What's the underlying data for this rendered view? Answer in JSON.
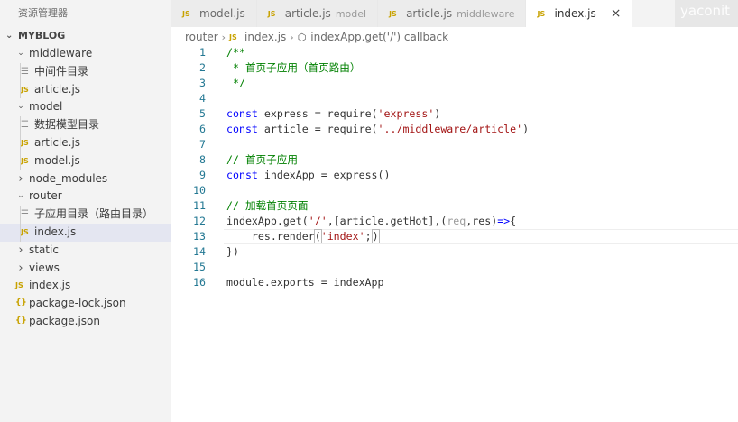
{
  "explorer": {
    "title": "资源管理器",
    "project": "MYBLOG",
    "items": [
      {
        "label": "middleware",
        "type": "folder",
        "open": true,
        "depth": 1
      },
      {
        "label": "中间件目录",
        "type": "md",
        "depth": 2
      },
      {
        "label": "article.js",
        "type": "js",
        "depth": 2
      },
      {
        "label": "model",
        "type": "folder",
        "open": true,
        "depth": 1
      },
      {
        "label": "数据模型目录",
        "type": "md",
        "depth": 2
      },
      {
        "label": "article.js",
        "type": "js",
        "depth": 2
      },
      {
        "label": "model.js",
        "type": "js",
        "depth": 2
      },
      {
        "label": "node_modules",
        "type": "folder",
        "open": false,
        "depth": 1
      },
      {
        "label": "router",
        "type": "folder",
        "open": true,
        "depth": 1
      },
      {
        "label": "子应用目录（路由目录）",
        "type": "md",
        "depth": 2
      },
      {
        "label": "index.js",
        "type": "js",
        "depth": 2,
        "active": true
      },
      {
        "label": "static",
        "type": "folder",
        "open": false,
        "depth": 1
      },
      {
        "label": "views",
        "type": "folder",
        "open": false,
        "depth": 1
      },
      {
        "label": "index.js",
        "type": "js",
        "depth": 1
      },
      {
        "label": "package-lock.json",
        "type": "json",
        "depth": 1
      },
      {
        "label": "package.json",
        "type": "json",
        "depth": 1
      }
    ]
  },
  "tabs": [
    {
      "label": "model.js",
      "desc": ""
    },
    {
      "label": "article.js",
      "desc": "model"
    },
    {
      "label": "article.js",
      "desc": "middleware"
    },
    {
      "label": "index.js",
      "desc": "",
      "active": true
    }
  ],
  "watermark": "yaconit",
  "icons": {
    "js": "JS",
    "json": "{}",
    "close": "×"
  },
  "breadcrumb": {
    "folder": "router",
    "file": "index.js",
    "symbol": "indexApp.get('/') callback"
  },
  "code": [
    {
      "n": "1",
      "tokens": [
        {
          "t": "/**",
          "c": "cmt"
        }
      ]
    },
    {
      "n": "2",
      "tokens": [
        {
          "t": " * 首页子应用（首页路由）",
          "c": "cmt"
        }
      ]
    },
    {
      "n": "3",
      "tokens": [
        {
          "t": " */",
          "c": "cmt"
        }
      ]
    },
    {
      "n": "4",
      "tokens": []
    },
    {
      "n": "5",
      "tokens": [
        {
          "t": "const",
          "c": "kw"
        },
        {
          "t": " express = require(",
          "c": ""
        },
        {
          "t": "'express'",
          "c": "str"
        },
        {
          "t": ")",
          "c": ""
        }
      ]
    },
    {
      "n": "6",
      "tokens": [
        {
          "t": "const",
          "c": "kw"
        },
        {
          "t": " article = require(",
          "c": ""
        },
        {
          "t": "'../middleware/article'",
          "c": "str"
        },
        {
          "t": ")",
          "c": ""
        }
      ]
    },
    {
      "n": "7",
      "tokens": []
    },
    {
      "n": "8",
      "tokens": [
        {
          "t": "// 首页子应用",
          "c": "cmt"
        }
      ]
    },
    {
      "n": "9",
      "tokens": [
        {
          "t": "const",
          "c": "kw"
        },
        {
          "t": " indexApp = express()",
          "c": ""
        }
      ]
    },
    {
      "n": "10",
      "tokens": []
    },
    {
      "n": "11",
      "tokens": [
        {
          "t": "// 加载首页页面",
          "c": "cmt"
        }
      ]
    },
    {
      "n": "12",
      "tokens": [
        {
          "t": "indexApp.get(",
          "c": ""
        },
        {
          "t": "'/'",
          "c": "str"
        },
        {
          "t": ",[article.getHot],(",
          "c": ""
        },
        {
          "t": "req",
          "c": "param"
        },
        {
          "t": ",res)",
          "c": ""
        },
        {
          "t": "=>",
          "c": "kw"
        },
        {
          "t": "{",
          "c": ""
        }
      ]
    },
    {
      "n": "13",
      "tokens": [
        {
          "t": "    res.render",
          "c": ""
        },
        {
          "t": "(",
          "c": "bracket"
        },
        {
          "t": "'index'",
          "c": "str"
        },
        {
          "t": ";",
          "c": ""
        },
        {
          "t": ")",
          "c": "bracket"
        }
      ],
      "current": true
    },
    {
      "n": "14",
      "tokens": [
        {
          "t": "})",
          "c": ""
        }
      ]
    },
    {
      "n": "15",
      "tokens": []
    },
    {
      "n": "16",
      "tokens": [
        {
          "t": "module.exports = indexApp",
          "c": ""
        }
      ]
    }
  ]
}
